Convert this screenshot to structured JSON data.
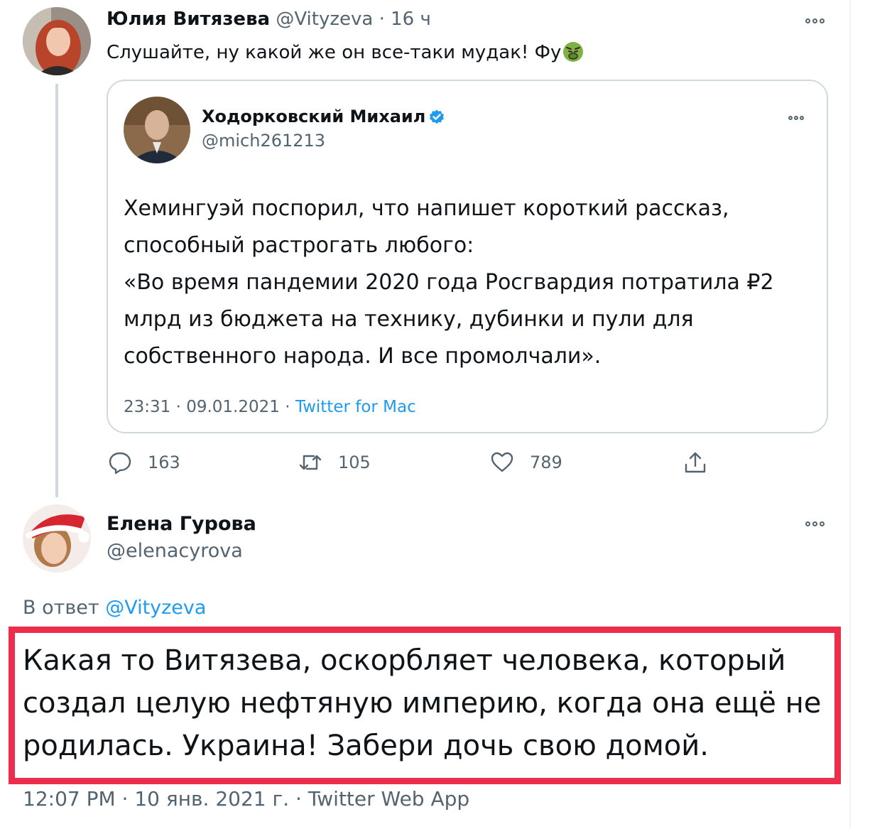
{
  "tweet1": {
    "name": "Юлия Витязева",
    "handle": "@Vityzeva",
    "separator": "·",
    "time": "16 ч",
    "text": "Слушайте, ну какой же он все-таки мудак! Фу",
    "emoji_icon": "nauseated-face-emoji"
  },
  "quote": {
    "name": "Ходорковский Михаил",
    "handle": "@mich261213",
    "verified_icon": "verified-badge-icon",
    "lines": [
      "Хемингуэй поспорил, что напишет короткий рассказ,",
      "способный растрогать любого:",
      "«Во время пандемии 2020 года Росгвардия потратила ₽2",
      "млрд из бюджета на технику, дубинки и пули для",
      "собственного народа. И все промолчали»."
    ],
    "datetime": "23:31 · 09.01.2021 · ",
    "source": "Twitter for Mac"
  },
  "actions": {
    "replies": "163",
    "retweets": "105",
    "likes": "789"
  },
  "tweet2": {
    "name": "Елена Гурова",
    "handle": "@elenacyrova",
    "replying_prefix": "В ответ ",
    "replying_to": "@Vityzeva",
    "lines": [
      "Какая то Витязева, оскорбляет человека, который",
      "создал целую нефтяную империю, когда она ещё не",
      "родилась. Украина! Забери дочь свою домой."
    ],
    "meta": "12:07 PM · 10 янв. 2021 г. · Twitter Web App"
  },
  "colors": {
    "accent": "#1d9bf0",
    "highlight_border": "#ee2c4c",
    "muted_text": "#536471"
  }
}
